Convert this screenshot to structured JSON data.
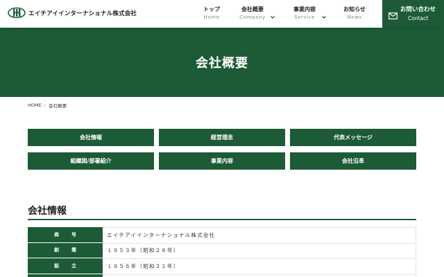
{
  "header": {
    "logo_text": "エイチアイインターナショナル株式会社",
    "nav": [
      {
        "jp": "トップ",
        "en": "Home"
      },
      {
        "jp": "会社概要",
        "en": "Company"
      },
      {
        "jp": "事業内容",
        "en": "Service"
      },
      {
        "jp": "お知らせ",
        "en": "News"
      }
    ],
    "contact": {
      "jp": "お問い合わせ",
      "en": "Contact"
    }
  },
  "hero": {
    "title": "会社概要"
  },
  "breadcrumb": {
    "home": "HOME",
    "current": "会社概要"
  },
  "buttons": [
    {
      "label": "会社情報"
    },
    {
      "label": "経営理念"
    },
    {
      "label": "代表メッセージ"
    },
    {
      "label": "組織図/部署紹介"
    },
    {
      "label": "事業内容"
    },
    {
      "label": "会社沿革"
    }
  ],
  "section": {
    "title": "会社情報"
  },
  "table": {
    "rows": [
      {
        "label": "商号",
        "value": "エイチアイインターナショナル株式会社"
      },
      {
        "label": "創業",
        "value": "１９５３年（昭和２８年）"
      },
      {
        "label": "設立",
        "value": "１９５６年（昭和３１年）"
      },
      {
        "label": "",
        "value": ""
      }
    ]
  },
  "colors": {
    "brand_green": "#1d5b37"
  },
  "icons": [
    "logo-mark-icon",
    "chevron-down-icon",
    "mail-icon",
    "chevron-right-icon"
  ]
}
